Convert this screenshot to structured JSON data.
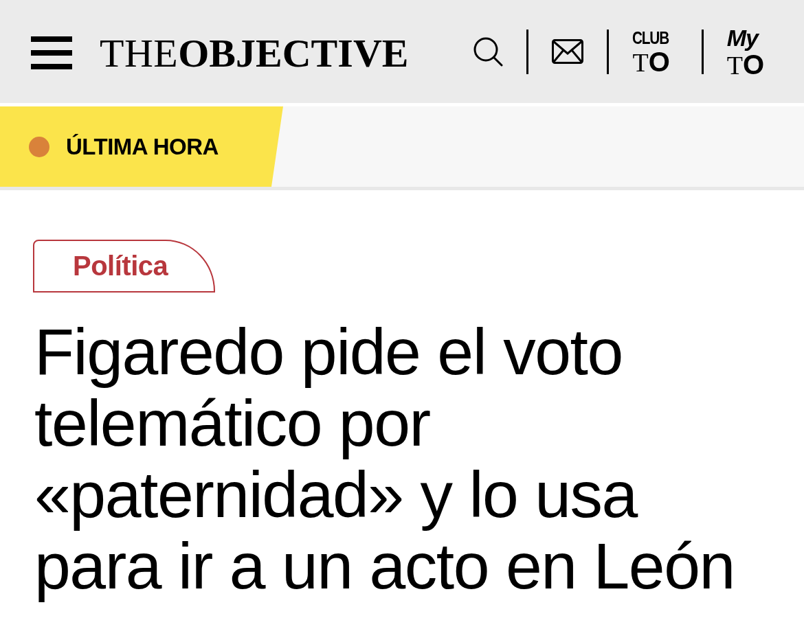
{
  "header": {
    "logo": "THE**OBJECTIVE**",
    "links": [
      {
        "kind": "club",
        "top": "CLUB",
        "bottom": "T**O**"
      },
      {
        "kind": "my",
        "top": "My",
        "bottom": "T**O**"
      }
    ]
  },
  "breaking": {
    "label": "ÚLTIMA HORA"
  },
  "article": {
    "category": "Política",
    "headline": "Figaredo pide el voto telemático por «paternidad» y lo usa para ir a un acto en León"
  }
}
